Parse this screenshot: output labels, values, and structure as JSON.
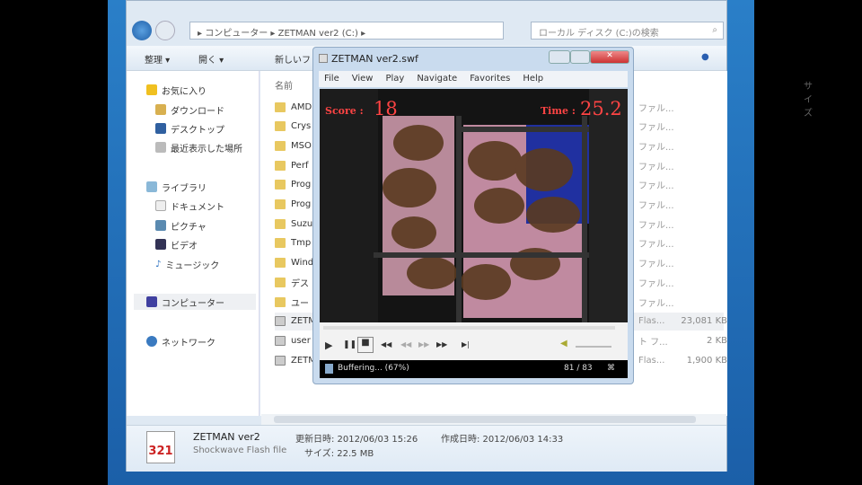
{
  "explorer": {
    "breadcrumb": [
      "コンピューター",
      "ZETMAN ver2 (C:)"
    ],
    "search_placeholder": "ローカル ディスク (C:)の検索",
    "toolbar": {
      "organize": "整理 ▾",
      "open": "開く ▾",
      "new_folder": "新しいフ"
    },
    "sidebar": {
      "favorites": "お気に入り",
      "download": "ダウンロード",
      "desktop": "デスクトップ",
      "recent": "最近表示した場所",
      "libraries": "ライブラリ",
      "documents": "ドキュメント",
      "pictures": "ピクチャ",
      "videos": "ビデオ",
      "music": "ミュージック",
      "computer": "コンピューター",
      "network": "ネットワーク"
    },
    "columns": {
      "name": "名前",
      "size": "サイズ"
    },
    "files": [
      {
        "name": "AMD",
        "type": "ファル..."
      },
      {
        "name": "Crys",
        "type": "ファル..."
      },
      {
        "name": "MSO",
        "type": "ファル..."
      },
      {
        "name": "Perf",
        "type": "ファル..."
      },
      {
        "name": "Prog",
        "type": "ファル..."
      },
      {
        "name": "Prog",
        "type": "ファル..."
      },
      {
        "name": "Suzu",
        "type": "ファル..."
      },
      {
        "name": "Tmp",
        "type": "ファル..."
      },
      {
        "name": "Wind",
        "type": "ファル..."
      },
      {
        "name": "デス",
        "type": "ファル..."
      },
      {
        "name": "ユー",
        "type": "ファル..."
      },
      {
        "name": "ZETM",
        "type": "Flas...",
        "size": "23,081 KB"
      },
      {
        "name": "user",
        "type": "ト フ...",
        "size": "2 KB"
      },
      {
        "name": "ZETM",
        "type": "Flas...",
        "size": "1,900 KB"
      }
    ],
    "details": {
      "name": "ZETMAN ver2",
      "type": "Shockwave Flash file",
      "modified": "更新日時: 2012/06/03 15:26",
      "created": "作成日時: 2012/06/03 14:33",
      "size": "サイズ: 22.5 MB"
    }
  },
  "player": {
    "title": "ZETMAN ver2.swf",
    "menu": [
      "File",
      "View",
      "Play",
      "Navigate",
      "Favorites",
      "Help"
    ],
    "score_label": "Score :",
    "score": "18",
    "time_label": "Time :",
    "time": "25.2",
    "status": "Buffering... (67%)",
    "frames": "81 / 83"
  }
}
